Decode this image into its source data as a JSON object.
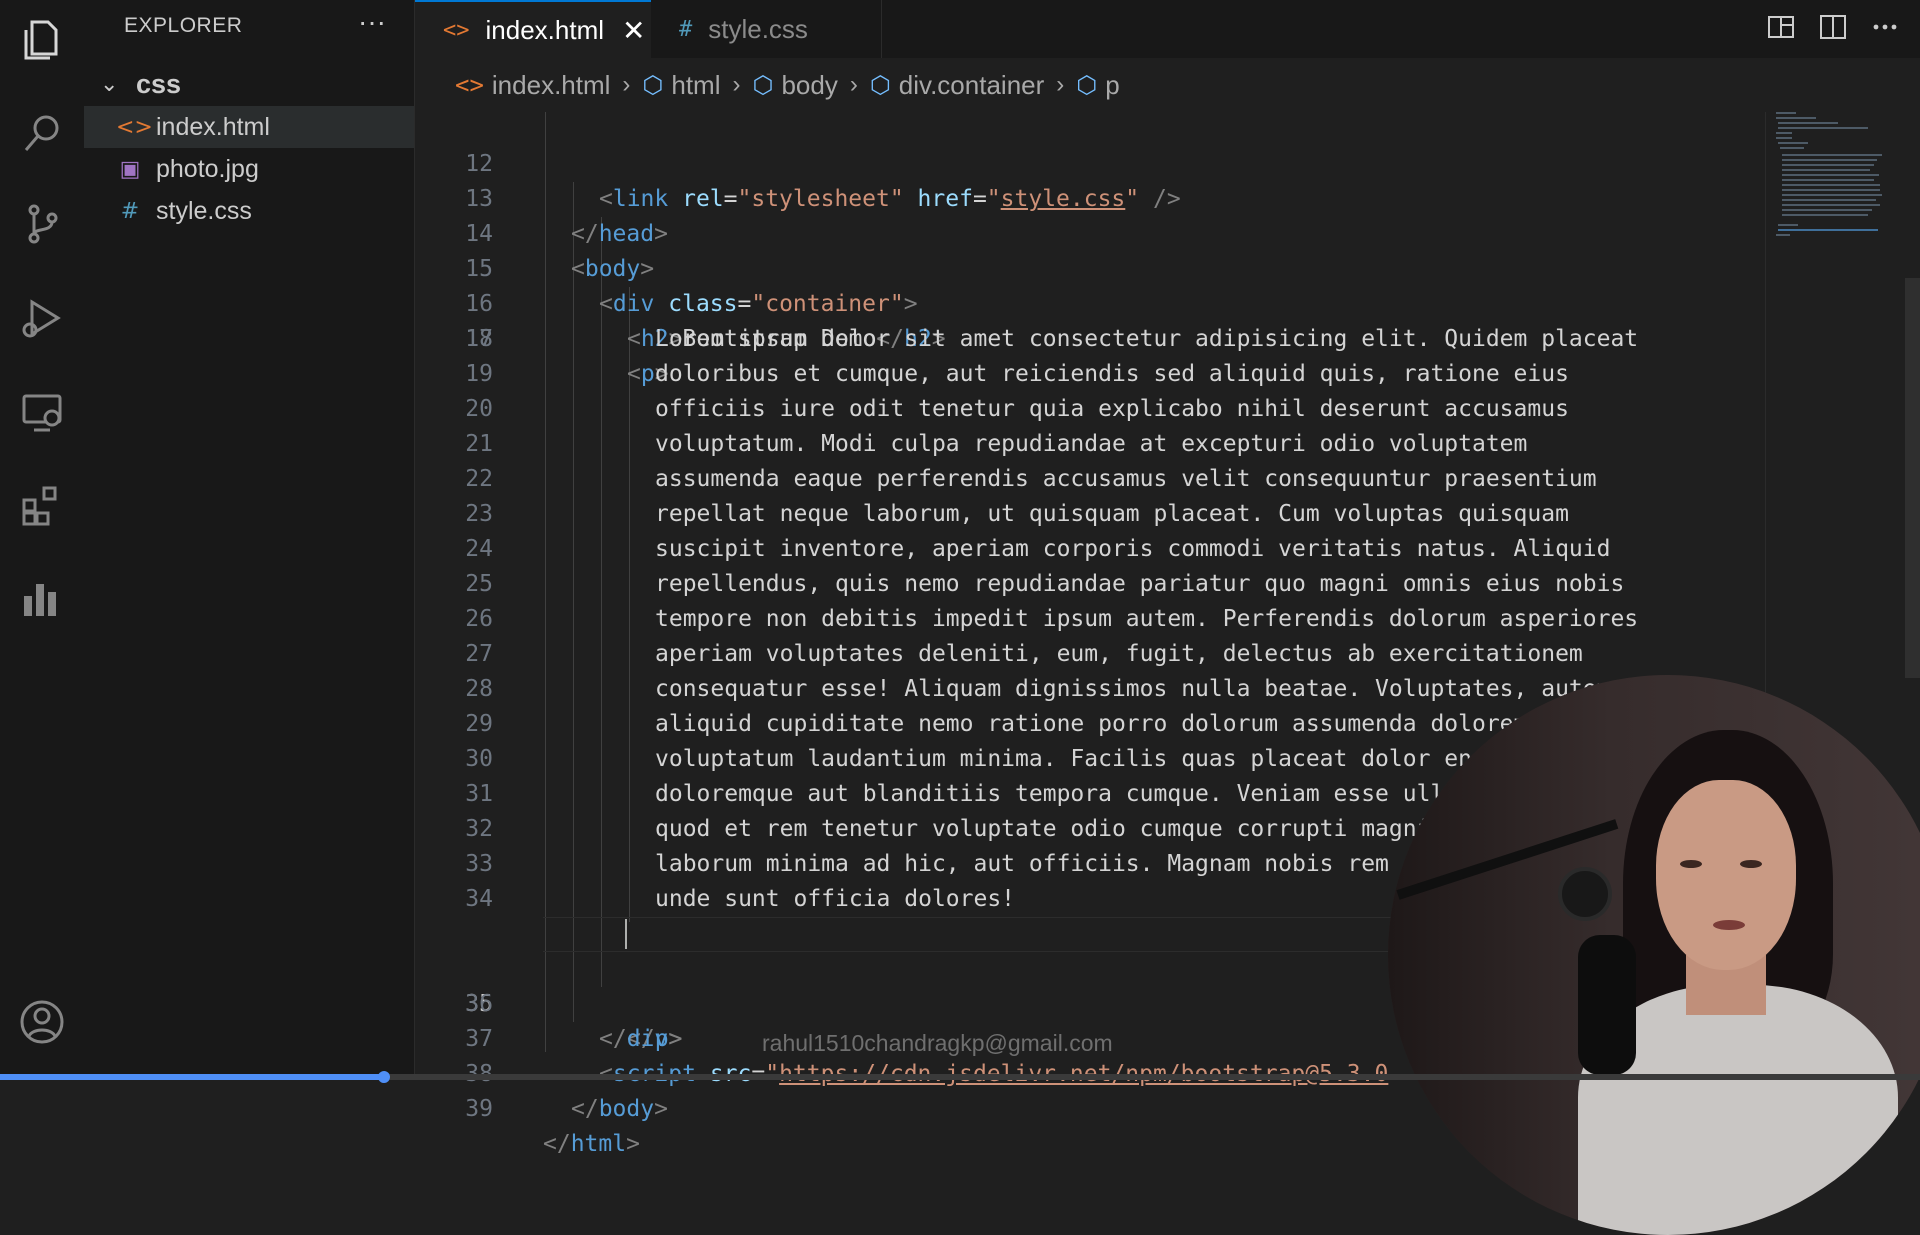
{
  "activity_bar": {
    "icons": [
      "files-icon",
      "search-icon",
      "source-control-icon",
      "run-debug-icon",
      "remote-explorer-icon",
      "extensions-icon",
      "chart-icon",
      "account-icon"
    ]
  },
  "sidebar": {
    "header": "EXPLORER",
    "more": "···",
    "folder": "css",
    "files": [
      {
        "name": "index.html",
        "icon": "<>",
        "color": "#e37933",
        "active": true
      },
      {
        "name": "photo.jpg",
        "icon": "▣",
        "color": "#a074c4",
        "active": false
      },
      {
        "name": "style.css",
        "icon": "#",
        "color": "#519aba",
        "active": false
      }
    ]
  },
  "tabs": [
    {
      "label": "index.html",
      "icon": "<>",
      "active": true,
      "close": "✕"
    },
    {
      "label": "style.css",
      "icon": "#",
      "active": false
    }
  ],
  "breadcrumb": {
    "file": "index.html",
    "items": [
      "html",
      "body",
      "div.container",
      "p"
    ]
  },
  "editor": {
    "current_line": 35,
    "lines": [
      {
        "n": "12",
        "indent": 2
      },
      {
        "n": "13",
        "indent": 1
      },
      {
        "n": "14",
        "indent": 1
      },
      {
        "n": "15",
        "indent": 2
      },
      {
        "n": "16",
        "indent": 3
      },
      {
        "n": "17",
        "indent": 3
      },
      {
        "n": "18",
        "text": "Lorem ipsum dolor sit amet consectetur adipisicing elit. Quidem placeat"
      },
      {
        "n": "19",
        "text": "doloribus et cumque, aut reiciendis sed aliquid quis, ratione eius"
      },
      {
        "n": "20",
        "text": "officiis iure odit tenetur quia explicabo nihil deserunt accusamus"
      },
      {
        "n": "21",
        "text": "voluptatum. Modi culpa repudiandae at excepturi odio voluptatem"
      },
      {
        "n": "22",
        "text": "assumenda eaque perferendis accusamus velit consequuntur praesentium"
      },
      {
        "n": "23",
        "text": "repellat neque laborum, ut quisquam placeat. Cum voluptas quisquam"
      },
      {
        "n": "24",
        "text": "suscipit inventore, aperiam corporis commodi veritatis natus. Aliquid"
      },
      {
        "n": "25",
        "text": "repellendus, quis nemo repudiandae pariatur quo magni omnis eius nobis"
      },
      {
        "n": "26",
        "text": "tempore non debitis impedit ipsum autem. Perferendis dolorum asperiores"
      },
      {
        "n": "27",
        "text": "aperiam voluptates deleniti, eum, fugit, delectus ab exercitationem"
      },
      {
        "n": "28",
        "text": "consequatur esse! Aliquam dignissimos nulla beatae. Voluptates, autem"
      },
      {
        "n": "29",
        "text": "aliquid cupiditate nemo ratione porro dolorum assumenda dolorem"
      },
      {
        "n": "30",
        "text": "voluptatum laudantium minima. Facilis quas placeat dolor en"
      },
      {
        "n": "31",
        "text": "doloremque aut blanditiis tempora cumque. Veniam esse ull"
      },
      {
        "n": "32",
        "text": "quod et rem tenetur voluptate odio cumque corrupti magni"
      },
      {
        "n": "33",
        "text": "laborum minima ad hic, aut officiis. Magnam nobis rem"
      },
      {
        "n": "34",
        "text": "unde sunt officia dolores!"
      },
      {
        "n": "35"
      },
      {
        "n": "36"
      },
      {
        "n": "37"
      },
      {
        "n": "38"
      },
      {
        "n": "39"
      }
    ],
    "tokens": {
      "link": "link",
      "rel_attr": "rel",
      "rel_val": "\"stylesheet\"",
      "href_attr": "href",
      "href_val": "style.css",
      "self_close": " />",
      "head": "head",
      "body": "body",
      "div": "div",
      "class_attr": "class",
      "class_val": "\"container\"",
      "h2": "h2",
      "h2_text": "Bootstrap Demo",
      "p": "p",
      "script": "script",
      "src_attr": "src",
      "src_val": "https://cdn.jsdelivr.net/npm/bootstrap@5.3.0",
      "html": "html"
    }
  },
  "watermark": "rahul1510chandragkp@gmail.com",
  "video_progress": 0.2
}
